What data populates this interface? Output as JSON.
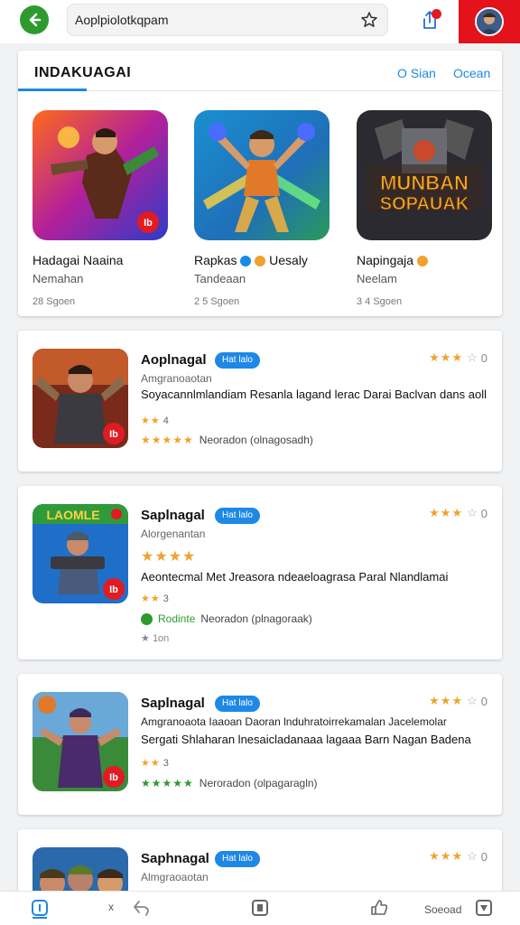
{
  "header": {
    "search_value": "Aoplpiolotkqpam"
  },
  "featured": {
    "title": "INDAKUAGAI",
    "action1": "O Sian",
    "action2": "Ocean",
    "items": [
      {
        "name": "Hadagai Naaina",
        "sub": "Nemahan",
        "meta": "28 Sgoen"
      },
      {
        "name": "Rapkas",
        "sub": "Tandeaan",
        "meta": "2 5 Sgoen",
        "name_suffix": "Uesaly"
      },
      {
        "name": "Napingaja",
        "sub": "Neelam",
        "meta": "3 4 Sgoen",
        "icon_text1": "MUNBAN",
        "icon_text2": "SOPAUAK"
      }
    ]
  },
  "cards": [
    {
      "title": "Aoplnagal",
      "badge": "Hat lalo",
      "rating_right": "0",
      "sub": "Amgranoaotan",
      "desc": "Soyacannlmlandiam Resanla lagand lerac Darai Baclvan dans aoll",
      "small_rating": "4",
      "line": "Neoradon  (olnagosadh)",
      "icon_badge": "Ib"
    },
    {
      "title": "Saplnagal",
      "badge": "Hat lalo",
      "rating_right": "0",
      "sub": "Alorgenantan",
      "desc": "Aeontecmal Met Jreasora  ndeaeloagrasa Paral Nlandlamai",
      "small_rating": "3",
      "line_prefix": "Rodinte",
      "line": "Neoradon  (plnagoraak)",
      "footer": "1on",
      "icon_banner": "LAOMLE",
      "icon_badge": "Ib"
    },
    {
      "title": "Saplnagal",
      "badge": "Hat lalo",
      "rating_right": "0",
      "sub": "Amgranoaota Iaaoan Daoran lnduhratoirrekamalan Jacelemolar",
      "desc": "Sergati Shlaharan lnesaicladanaaa lagaaa Barn Nagan Badena",
      "small_rating": "3",
      "line": "Neroradon  (olpagaragln)",
      "icon_badge": "Ib"
    },
    {
      "title": "Saphnagal",
      "badge": "Hat lalo",
      "rating_right": "0",
      "sub": "Almgraoaotan"
    }
  ],
  "bottom_nav": {
    "label": "Soeoad"
  },
  "colors": {
    "accent": "#1e88e5",
    "green": "#2e9a2e",
    "red": "#e3121b",
    "star": "#f0a22e"
  }
}
